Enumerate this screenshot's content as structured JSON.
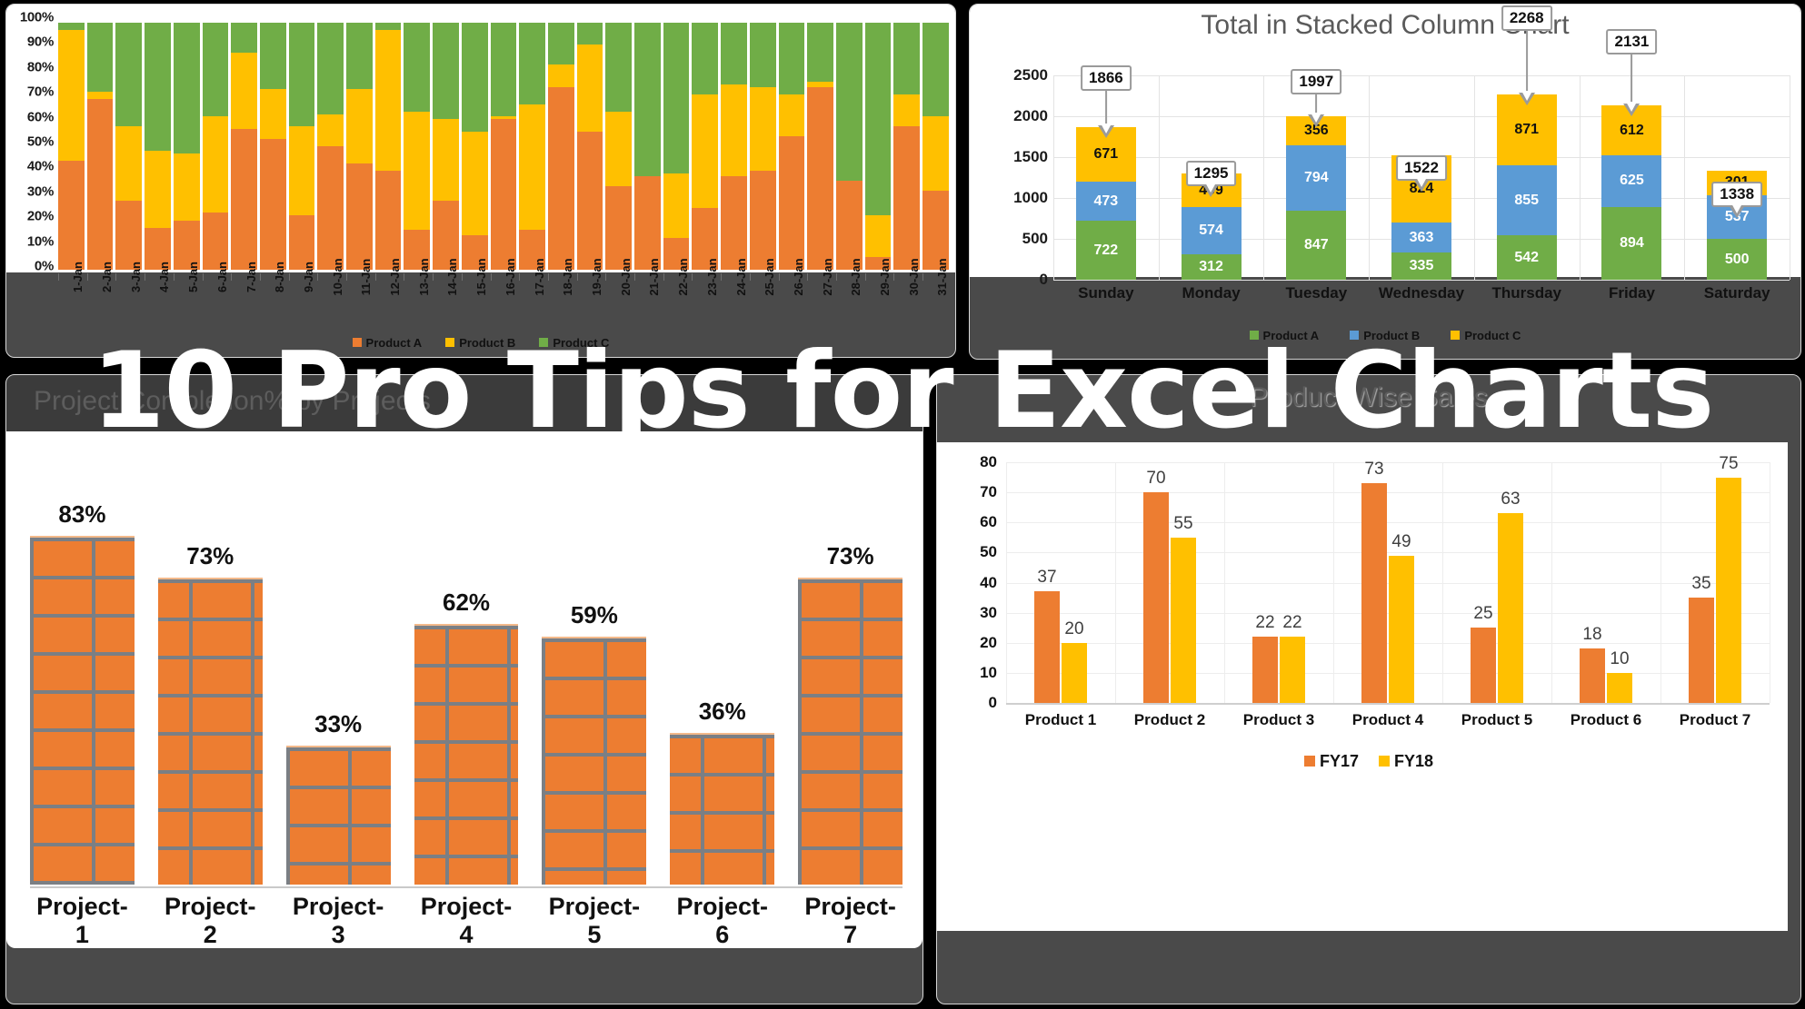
{
  "overlay": {
    "title": "10 Pro Tips for Excel Charts"
  },
  "colors": {
    "product_a_orange": "#ED7D31",
    "product_b_yellow": "#FFC000",
    "product_c_green": "#70AD47",
    "blue": "#5B9BD5",
    "panel_dark": "#4A4A4A"
  },
  "chart_data": [
    {
      "id": "stacked-100-percent",
      "type": "bar",
      "stacked": true,
      "normalized": true,
      "title": "",
      "xlabel": "",
      "ylabel": "",
      "ylim": [
        0,
        100
      ],
      "ytick_labels": [
        "100%",
        "90%",
        "80%",
        "70%",
        "60%",
        "50%",
        "40%",
        "30%",
        "20%",
        "10%",
        "0%"
      ],
      "grid": false,
      "legend_position": "bottom",
      "categories": [
        "1-Jan",
        "2-Jan",
        "3-Jan",
        "4-Jan",
        "5-Jan",
        "6-Jan",
        "7-Jan",
        "8-Jan",
        "9-Jan",
        "10-Jan",
        "11-Jan",
        "12-Jan",
        "13-Jan",
        "14-Jan",
        "15-Jan",
        "16-Jan",
        "17-Jan",
        "18-Jan",
        "19-Jan",
        "20-Jan",
        "21-Jan",
        "22-Jan",
        "23-Jan",
        "24-Jan",
        "25-Jan",
        "26-Jan",
        "27-Jan",
        "28-Jan",
        "29-Jan",
        "30-Jan",
        "31-Jan"
      ],
      "series": [
        {
          "name": "Product A",
          "color": "#ED7D31",
          "values": [
            44,
            69,
            28,
            17,
            20,
            23,
            57,
            53,
            22,
            50,
            43,
            40,
            16,
            28,
            14,
            61,
            16,
            74,
            56,
            34,
            38,
            13,
            25,
            38,
            40,
            54,
            74,
            36,
            5,
            58,
            32
          ]
        },
        {
          "name": "Product B",
          "color": "#FFC000",
          "values": [
            53,
            3,
            30,
            31,
            27,
            39,
            31,
            20,
            36,
            13,
            30,
            57,
            48,
            33,
            42,
            1,
            51,
            9,
            35,
            30,
            0,
            26,
            46,
            37,
            34,
            17,
            2,
            0,
            17,
            13,
            30
          ]
        },
        {
          "name": "Product C",
          "color": "#70AD47",
          "values": [
            3,
            28,
            42,
            52,
            53,
            38,
            12,
            27,
            42,
            37,
            27,
            3,
            36,
            39,
            44,
            38,
            33,
            17,
            9,
            36,
            62,
            61,
            29,
            25,
            26,
            29,
            24,
            64,
            78,
            29,
            38
          ]
        }
      ]
    },
    {
      "id": "total-in-stacked-column",
      "type": "bar",
      "stacked": true,
      "title": "Total in Stacked Column Chart",
      "xlabel": "",
      "ylabel": "",
      "ylim": [
        0,
        2500
      ],
      "ytick_labels": [
        "0",
        "500",
        "1000",
        "1500",
        "2000",
        "2500"
      ],
      "grid": true,
      "legend_position": "bottom",
      "categories": [
        "Sunday",
        "Monday",
        "Tuesday",
        "Wednesday",
        "Thursday",
        "Friday",
        "Saturday"
      ],
      "totals": [
        1866,
        1295,
        1997,
        1522,
        2268,
        2131,
        1338
      ],
      "series": [
        {
          "name": "Product A",
          "color": "#70AD47",
          "values": [
            722,
            312,
            847,
            335,
            542,
            894,
            500
          ]
        },
        {
          "name": "Product B",
          "color": "#5B9BD5",
          "values": [
            473,
            574,
            794,
            363,
            855,
            625,
            537
          ]
        },
        {
          "name": "Product C",
          "color": "#FFC000",
          "values": [
            671,
            409,
            356,
            824,
            871,
            612,
            301
          ]
        }
      ]
    },
    {
      "id": "project-completion",
      "type": "bar",
      "title": "Project Completion% by Projects",
      "xlabel": "",
      "ylabel": "",
      "ylim": [
        0,
        100
      ],
      "grid": false,
      "legend_position": "none",
      "fill_style": "brick-texture",
      "categories": [
        "Project-1",
        "Project-2",
        "Project-3",
        "Project-4",
        "Project-5",
        "Project-6",
        "Project-7"
      ],
      "values": [
        83,
        73,
        33,
        62,
        59,
        36,
        73
      ],
      "value_labels": [
        "83%",
        "73%",
        "33%",
        "62%",
        "59%",
        "36%",
        "73%"
      ]
    },
    {
      "id": "product-wise-sales",
      "type": "bar",
      "title": "Product Wise Sales",
      "xlabel": "",
      "ylabel": "",
      "ylim": [
        0,
        80
      ],
      "ytick_labels": [
        "0",
        "10",
        "20",
        "30",
        "40",
        "50",
        "60",
        "70",
        "80"
      ],
      "grid": true,
      "legend_position": "bottom",
      "categories": [
        "Product 1",
        "Product 2",
        "Product 3",
        "Product 4",
        "Product 5",
        "Product 6",
        "Product 7"
      ],
      "series": [
        {
          "name": "FY17",
          "color": "#ED7D31",
          "values": [
            37,
            70,
            22,
            73,
            25,
            18,
            35
          ]
        },
        {
          "name": "FY18",
          "color": "#FFC000",
          "values": [
            20,
            55,
            22,
            49,
            63,
            10,
            75
          ]
        }
      ]
    }
  ]
}
